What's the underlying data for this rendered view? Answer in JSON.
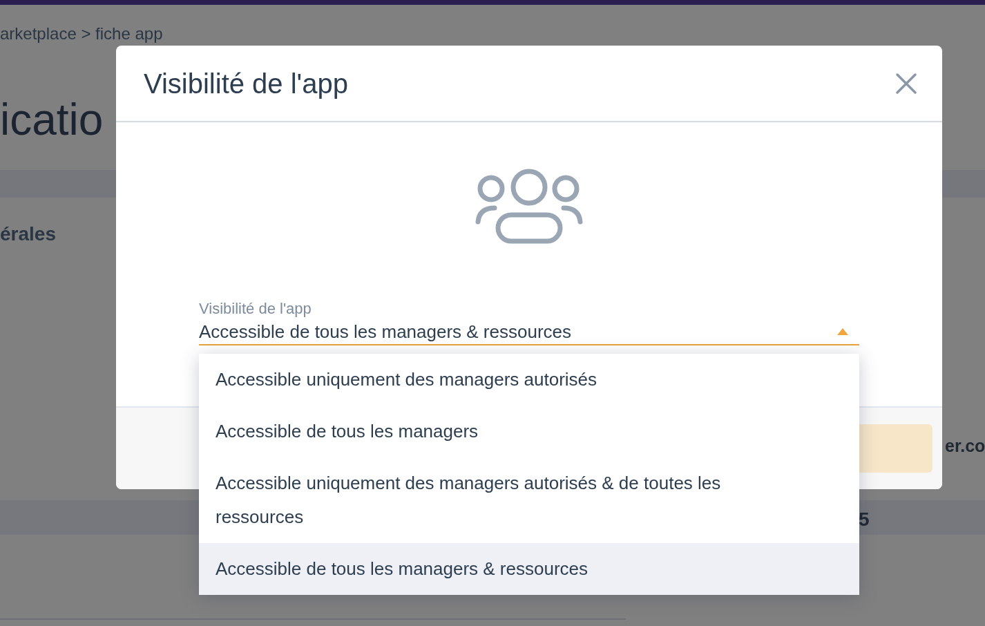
{
  "background_page": {
    "breadcrumb": "arketplace > fiche app",
    "page_title": "icatio",
    "section_title": "érales",
    "detail_texts": [
      "er.co",
      "5"
    ]
  },
  "modal": {
    "title": "Visibilité de l'app",
    "field": {
      "label": "Visibilité de l'app",
      "value": "Accessible de tous les managers & ressources",
      "expanded": true
    },
    "options": [
      {
        "label": "Accessible uniquement des managers autorisés",
        "selected": false
      },
      {
        "label": "Accessible de tous les managers",
        "selected": false
      },
      {
        "label": "Accessible uniquement des managers autorisés & de toutes les ressources",
        "selected": false
      },
      {
        "label": "Accessible de tous les managers & ressources",
        "selected": true
      }
    ],
    "submit_button": {
      "disabled": true
    }
  }
}
